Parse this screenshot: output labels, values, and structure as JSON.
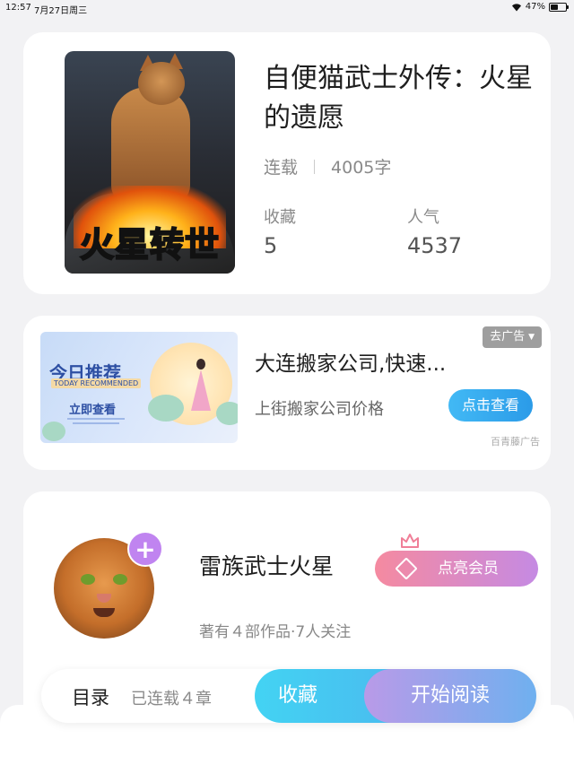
{
  "status_bar": {
    "time": "12:57",
    "date": "7月27日周三",
    "battery": "47%",
    "battery_level": 0.47
  },
  "book": {
    "cover_title": "火星转世",
    "title": "自便猫武士外传：火星的遗愿",
    "status": "连载",
    "word_count": "4005字",
    "favorites_label": "收藏",
    "favorites_value": "5",
    "popularity_label": "人气",
    "popularity_value": "4537"
  },
  "ad": {
    "banner_title": "今日推荐",
    "banner_subtitle": "TODAY RECOMMENDED",
    "banner_cta": "立即查看",
    "title": "大连搬家公司,快速...",
    "description": "上街搬家公司价格",
    "close_label": "去广告",
    "button_label": "点击查看",
    "source": "百青藤广告"
  },
  "author": {
    "name": "雷族武士火星",
    "meta": "著有４部作品·7人关注",
    "vip_label": "点亮会员"
  },
  "bottom_bar": {
    "toc_label": "目录",
    "chapters_label": "已连载４章",
    "favorite_label": "收藏",
    "read_label": "开始阅读"
  },
  "colors": {
    "favorite_button": "#43d3f3",
    "read_button_start": "#b99ae8",
    "read_button_end": "#6fb0ef",
    "vip_button_start": "#f58aa0",
    "vip_button_end": "#c58ae3",
    "plus_badge": "#c084f0",
    "ad_button": "#42b9f5"
  },
  "icons": {
    "wifi": "wifi-icon",
    "battery": "battery-icon",
    "plus": "plus-icon",
    "crown": "crown-icon",
    "diamond": "diamond-icon",
    "chevron": "chevron-down-icon"
  }
}
